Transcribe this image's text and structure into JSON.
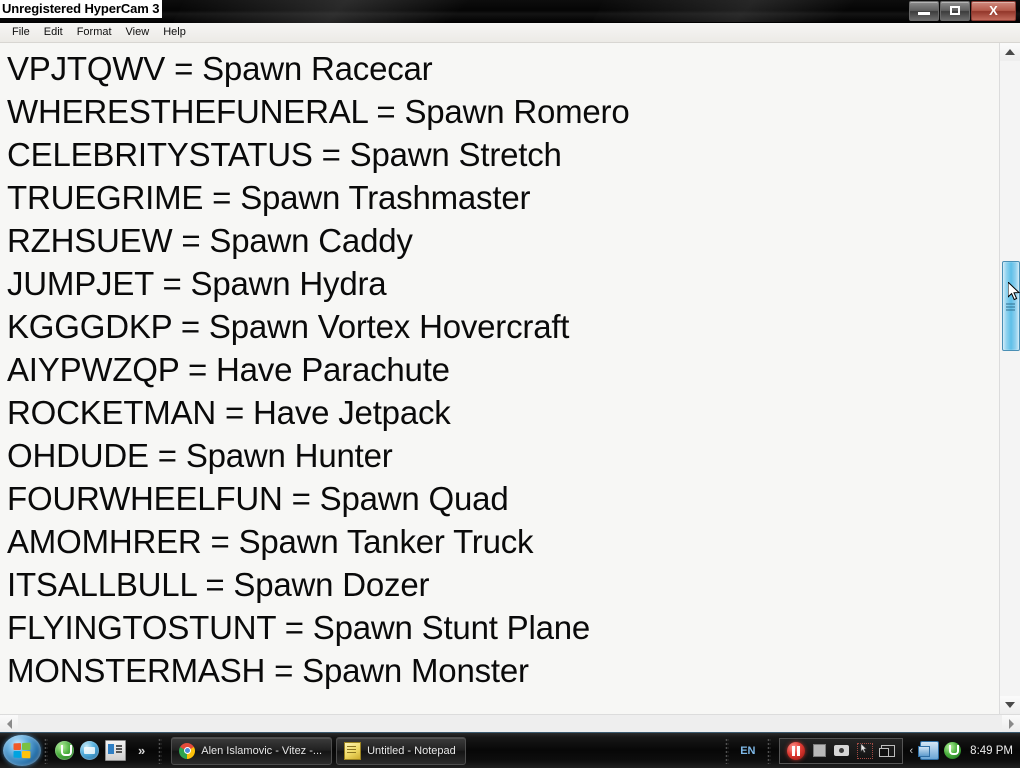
{
  "window": {
    "watermark": "Unregistered HyperCam 3",
    "menu": [
      "File",
      "Edit",
      "Format",
      "View",
      "Help"
    ],
    "controls": {
      "minimize": "minimize",
      "maximize": "maximize",
      "close": "X"
    }
  },
  "document": {
    "lines": [
      "VPJTQWV = Spawn Racecar",
      "WHERESTHEFUNERAL = Spawn Romero",
      "CELEBRITYSTATUS = Spawn Stretch",
      "TRUEGRIME = Spawn Trashmaster",
      "RZHSUEW = Spawn Caddy",
      "JUMPJET = Spawn Hydra",
      "KGGGDKP = Spawn Vortex Hovercraft",
      "AIYPWZQP = Have Parachute",
      "ROCKETMAN = Have Jetpack",
      "OHDUDE = Spawn Hunter",
      "FOURWHEELFUN = Spawn Quad",
      "AMOMHRER = Spawn Tanker Truck",
      "ITSALLBULL = Spawn Dozer",
      "FLYINGTOSTUNT = Spawn Stunt Plane",
      "MONSTERMASH = Spawn Monster"
    ]
  },
  "taskbar": {
    "start": "start-orb",
    "quick_launch": [
      "utorrent-icon",
      "blue-circle-icon",
      "media-window-icon"
    ],
    "overflow": "»",
    "tasks": [
      {
        "icon": "chrome-icon",
        "label": "Alen Islamovic - Vitez -..."
      },
      {
        "icon": "notepad-icon",
        "label": "Untitled - Notepad"
      }
    ],
    "tray": {
      "language": "EN",
      "hypercam_tools": [
        "pause-button",
        "stop-button",
        "camera-button",
        "cursor-button",
        "window-button"
      ],
      "chevron": "‹",
      "icons": [
        "network-icon",
        "utorrent-icon"
      ],
      "clock": "8:49 PM"
    }
  },
  "colors": {
    "text": "#0a0a0a",
    "paper": "#f7f7f5",
    "titlebar": "#000000",
    "scroll_thumb": "#5ebfe8",
    "close_button": "#b4594a",
    "taskbar": "#0d0d0d"
  }
}
